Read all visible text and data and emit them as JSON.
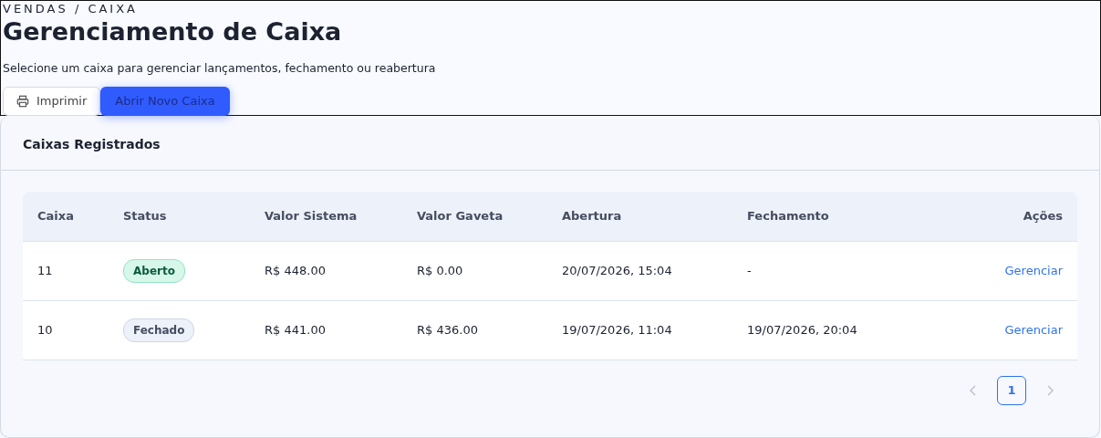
{
  "breadcrumb": "VENDAS / CAIXA",
  "title": "Gerenciamento de Caixa",
  "subtitle": "Selecione um caixa para gerenciar lançamentos, fechamento ou reabertura",
  "buttons": [
    {
      "label": "Imprimir",
      "kind": "outline"
    },
    {
      "label": "Abrir Novo Caixa",
      "kind": "primary"
    }
  ],
  "card": {
    "title": "Caixas Registrados",
    "table": {
      "columns": [
        "Caixa",
        "Status",
        "Valor Sistema",
        "Valor Gaveta",
        "Abertura",
        "Fechamento",
        "Ações"
      ],
      "rows": [
        {
          "caixa": "11",
          "status": {
            "label": "Aberto",
            "kind": "open"
          },
          "valor_sistema": "R$ 448.00",
          "valor_gaveta": "R$ 0.00",
          "abertura": "20/07/2026, 15:04",
          "fechamento": "-",
          "action": "Gerenciar"
        },
        {
          "caixa": "10",
          "status": {
            "label": "Fechado",
            "kind": "closed"
          },
          "valor_sistema": "R$ 441.00",
          "valor_gaveta": "R$ 436.00",
          "abertura": "19/07/2026, 11:04",
          "fechamento": "19/07/2026, 20:04",
          "action": "Gerenciar"
        }
      ]
    },
    "pagination": {
      "prev_disabled": true,
      "next_disabled": true,
      "pages": [
        {
          "label": "1",
          "selected": true
        }
      ]
    }
  }
}
